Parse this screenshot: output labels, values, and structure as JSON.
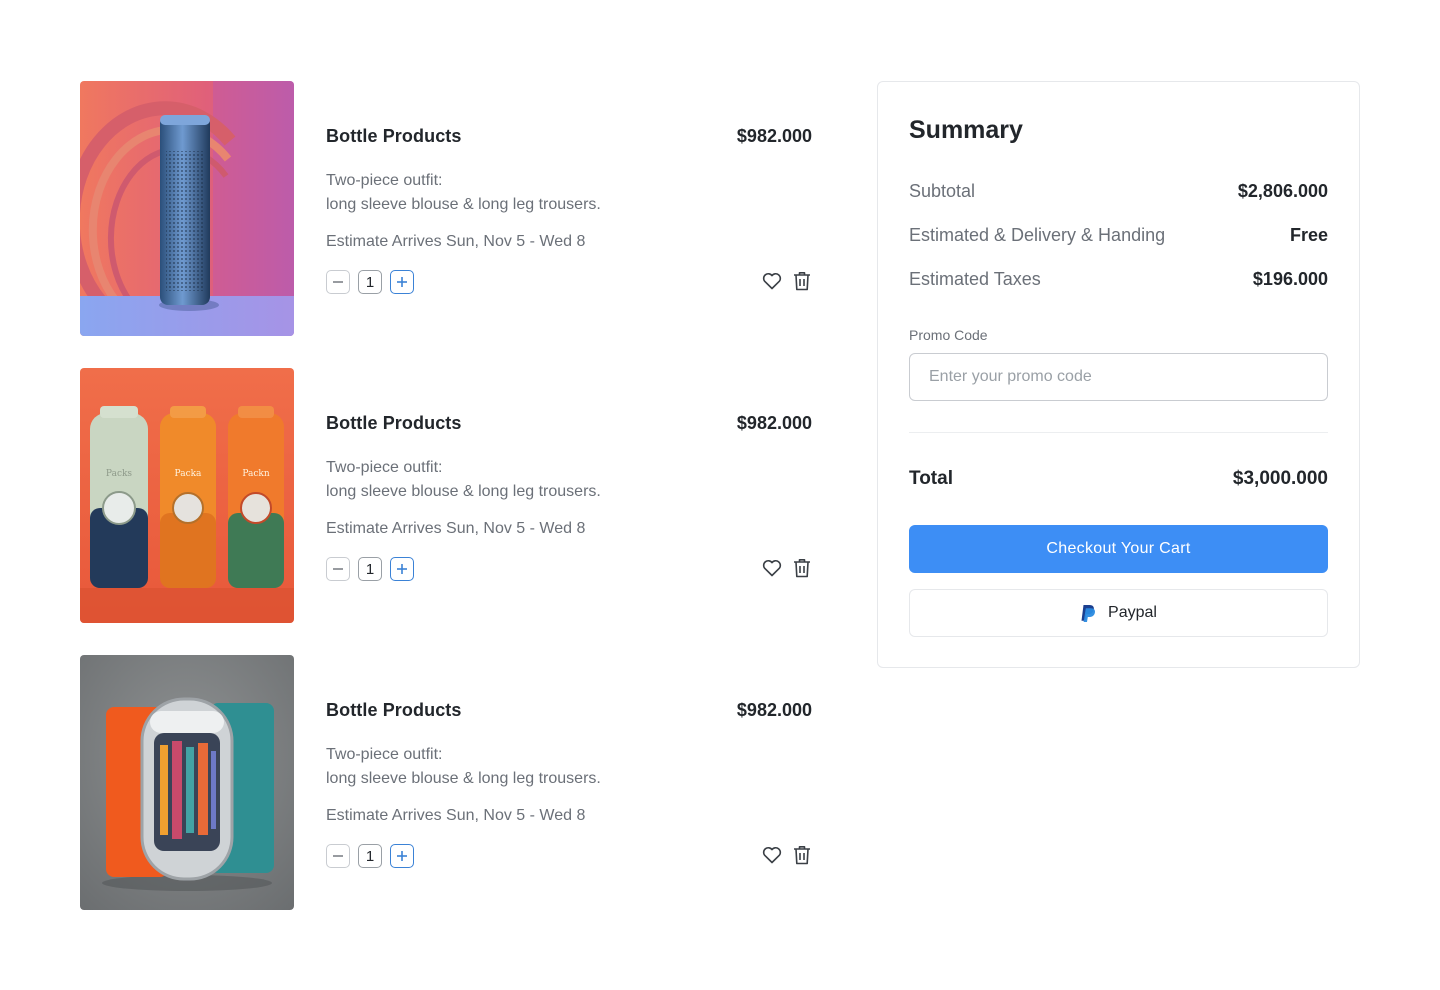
{
  "cart": {
    "items": [
      {
        "title": "Bottle Products",
        "price": "$982.000",
        "desc_line1": "Two-piece outfit:",
        "desc_line2": "long sleeve blouse & long leg trousers.",
        "eta": "Estimate Arrives Sun, Nov 5 - Wed 8",
        "quantity": "1",
        "image": "blue-metal-bottle-image"
      },
      {
        "title": "Bottle Products",
        "price": "$982.000",
        "desc_line1": "Two-piece outfit:",
        "desc_line2": "long sleeve blouse & long leg trousers.",
        "eta": "Estimate Arrives Sun, Nov 5 - Wed 8",
        "quantity": "1",
        "image": "three-colored-bottles-image",
        "image_labels": [
          "Packs",
          "Packa",
          "Packn"
        ]
      },
      {
        "title": "Bottle Products",
        "price": "$982.000",
        "desc_line1": "Two-piece outfit:",
        "desc_line2": "long sleeve blouse & long leg trousers.",
        "eta": "Estimate Arrives Sun, Nov 5 - Wed 8",
        "quantity": "1",
        "image": "capsule-packaging-image"
      }
    ],
    "icons": {
      "decrease": "minus-icon",
      "increase": "plus-icon",
      "wishlist": "heart-icon",
      "remove": "trash-icon"
    }
  },
  "summary": {
    "title": "Summary",
    "subtotal_label": "Subtotal",
    "subtotal_value": "$2,806.000",
    "delivery_label": "Estimated & Delivery & Handing",
    "delivery_value": "Free",
    "taxes_label": "Estimated Taxes",
    "taxes_value": "$196.000",
    "promo_label": "Promo Code",
    "promo_placeholder": "Enter your promo code",
    "promo_value": "",
    "total_label": "Total",
    "total_value": "$3,000.000",
    "checkout_label": "Checkout Your Cart",
    "paypal_label": "Paypal"
  },
  "colors": {
    "accent": "#3d8ef5",
    "plus_border": "#3b82d6",
    "text_primary": "#22262b",
    "text_secondary": "#6b7078"
  }
}
